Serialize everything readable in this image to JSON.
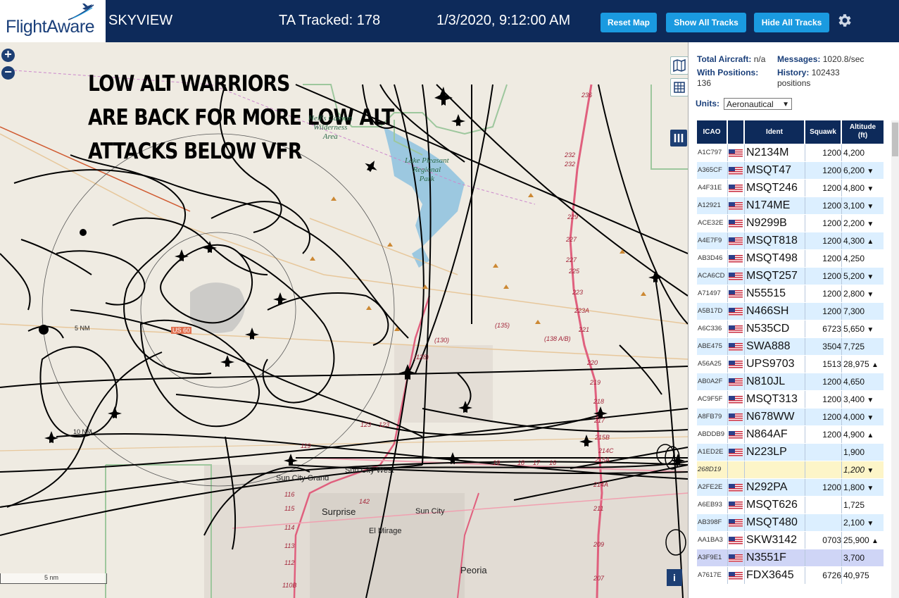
{
  "header": {
    "logo_text": "FlightAware",
    "app_title": "SKYVIEW",
    "ta_tracked": "TA Tracked: 178",
    "datetime": "1/3/2020, 9:12:00 AM",
    "buttons": {
      "reset_map": "Reset Map",
      "show_all_tracks": "Show All Tracks",
      "hide_all_tracks": "Hide All Tracks"
    },
    "settings_icon": "gear-icon"
  },
  "map": {
    "overlay_lines": [
      "LOW ALT WARRIORS",
      "ARE BACK FOR MORE LOW ALT",
      "ATTACKS BELOW VFR"
    ],
    "zoom_in": "+",
    "zoom_out": "−",
    "place_labels": {
      "surprise": "Surprise",
      "sun_city": "Sun City",
      "sun_city_grand": "Sun City Grand",
      "sun_city_west": "Sun City West",
      "el_mirage": "El Mirage",
      "peoria": "Peoria",
      "ring_5nm": "5 NM",
      "ring_10nm": "10 NM",
      "us60": "US 60"
    },
    "park_labels": {
      "lake_pleasant": "Lake Pleasant\nRegional\nPark",
      "wilderness": "Hell's Canyon\nWilderness\nArea"
    },
    "highway_labels": [
      "236",
      "232",
      "232",
      "229",
      "227",
      "227",
      "225",
      "223",
      "223A",
      "221",
      "220",
      "219",
      "218",
      "217",
      "215B",
      "214C",
      "215A",
      "214A",
      "211",
      "209",
      "207",
      "(130)",
      "(135)",
      "(138 A/B)",
      "(128)",
      "123",
      "123",
      "119",
      "116",
      "115",
      "114",
      "113",
      "112",
      "110B",
      "142",
      "18",
      "17",
      "16",
      "19"
    ],
    "scale_label": "5 nm",
    "info_button": "i"
  },
  "sidebar": {
    "stats": {
      "total_aircraft_label": "Total Aircraft:",
      "total_aircraft_value": "n/a",
      "messages_label": "Messages:",
      "messages_value": "1020.8/sec",
      "with_positions_label": "With Positions:",
      "with_positions_value": "136",
      "history_label": "History:",
      "history_value": "102433",
      "history_unit": "positions"
    },
    "units_label": "Units:",
    "units_value": "Aeronautical",
    "columns": {
      "icao": "ICAO",
      "ident": "Ident",
      "squawk": "Squawk",
      "altitude": "Altitude",
      "altitude_unit": "(ft)"
    },
    "rows": [
      {
        "icao": "A1C797",
        "ident": "N2134M",
        "squawk": "1200",
        "alt": "4,200",
        "trend": ""
      },
      {
        "icao": "A365CF",
        "ident": "MSQT47",
        "squawk": "1200",
        "alt": "6,200",
        "trend": "▼"
      },
      {
        "icao": "A4F31E",
        "ident": "MSQT246",
        "squawk": "1200",
        "alt": "4,800",
        "trend": "▼"
      },
      {
        "icao": "A12921",
        "ident": "N174ME",
        "squawk": "1200",
        "alt": "3,100",
        "trend": "▼"
      },
      {
        "icao": "ACE32E",
        "ident": "N9299B",
        "squawk": "1200",
        "alt": "2,200",
        "trend": "▼"
      },
      {
        "icao": "A4E7F9",
        "ident": "MSQT818",
        "squawk": "1200",
        "alt": "4,300",
        "trend": "▲"
      },
      {
        "icao": "AB3D46",
        "ident": "MSQT498",
        "squawk": "1200",
        "alt": "4,250",
        "trend": ""
      },
      {
        "icao": "ACA6CD",
        "ident": "MSQT257",
        "squawk": "1200",
        "alt": "5,200",
        "trend": "▼"
      },
      {
        "icao": "A71497",
        "ident": "N55515",
        "squawk": "1200",
        "alt": "2,800",
        "trend": "▼"
      },
      {
        "icao": "A5B17D",
        "ident": "N466SH",
        "squawk": "1200",
        "alt": "7,300",
        "trend": ""
      },
      {
        "icao": "A6C336",
        "ident": "N535CD",
        "squawk": "6723",
        "alt": "5,650",
        "trend": "▼"
      },
      {
        "icao": "ABE475",
        "ident": "SWA888",
        "squawk": "3504",
        "alt": "7,725",
        "trend": ""
      },
      {
        "icao": "A56A25",
        "ident": "UPS9703",
        "squawk": "1513",
        "alt": "28,975",
        "trend": "▲"
      },
      {
        "icao": "AB0A2F",
        "ident": "N810JL",
        "squawk": "1200",
        "alt": "4,650",
        "trend": ""
      },
      {
        "icao": "AC9F5F",
        "ident": "MSQT313",
        "squawk": "1200",
        "alt": "3,400",
        "trend": "▼"
      },
      {
        "icao": "A8FB79",
        "ident": "N678WW",
        "squawk": "1200",
        "alt": "4,000",
        "trend": "▼"
      },
      {
        "icao": "ABDDB9",
        "ident": "N864AF",
        "squawk": "1200",
        "alt": "4,900",
        "trend": "▲"
      },
      {
        "icao": "A1ED2E",
        "ident": "N223LP",
        "squawk": "",
        "alt": "1,900",
        "trend": ""
      },
      {
        "icao": "268D19",
        "ident": "",
        "squawk": "",
        "alt": "1,200",
        "trend": "▼",
        "nopos": true
      },
      {
        "icao": "A2FE2E",
        "ident": "N292PA",
        "squawk": "1200",
        "alt": "1,800",
        "trend": "▼"
      },
      {
        "icao": "A6EB93",
        "ident": "MSQT626",
        "squawk": "",
        "alt": "1,725",
        "trend": ""
      },
      {
        "icao": "AB398F",
        "ident": "MSQT480",
        "squawk": "",
        "alt": "2,100",
        "trend": "▼"
      },
      {
        "icao": "AA1BA3",
        "ident": "SKW3142",
        "squawk": "0703",
        "alt": "25,900",
        "trend": "▲"
      },
      {
        "icao": "A3F9E1",
        "ident": "N3551F",
        "squawk": "",
        "alt": "3,700",
        "trend": "",
        "highlight": true
      },
      {
        "icao": "A7617E",
        "ident": "FDX3645",
        "squawk": "6726",
        "alt": "40,975",
        "trend": ""
      }
    ]
  },
  "colors": {
    "header_bg": "#0d2a5a",
    "button_bg": "#1a9ae0",
    "row_even": "#dcefff",
    "row_highlight": "#cfd5f6",
    "row_nopos": "#fdf5c8",
    "map_bg": "#efebe2",
    "highway": "#e0607e",
    "track": "#000000"
  }
}
